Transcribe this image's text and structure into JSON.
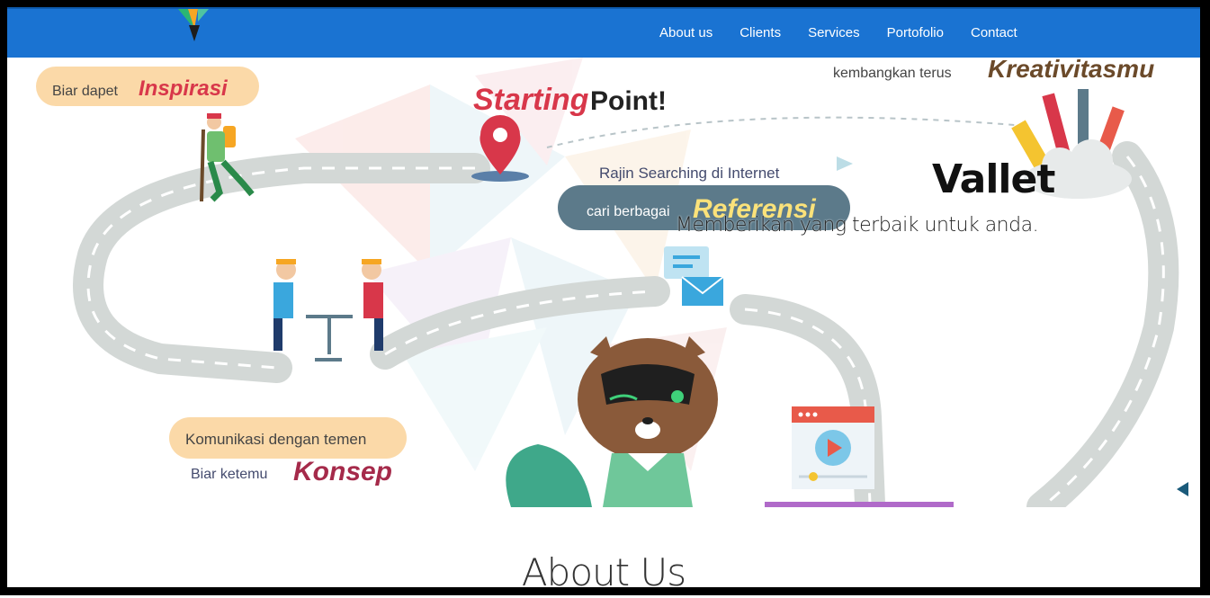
{
  "nav": {
    "brand_icon": "vallet-v-logo-icon",
    "links": [
      "About us",
      "Clients",
      "Services",
      "Portofolio",
      "Contact"
    ]
  },
  "hero": {
    "title": "Vallet",
    "subtitle": "Memberikan yang terbaik untuk anda.",
    "illustration": {
      "inspirasi_prefix": "Biar dapet",
      "inspirasi": "Inspirasi",
      "starting": "Starting",
      "point": "Point!",
      "searching": "Rajin Searching di Internet",
      "referensi_prefix": "cari berbagai",
      "referensi": "Referensi",
      "kreativitas_prefix": "kembangkan terus",
      "kreativitas": "Kreativitasmu",
      "komunikasi": "Komunikasi dengan temen",
      "konsep_prefix": "Biar ketemu",
      "konsep": "Konsep"
    },
    "carousel_prev_icon": "triangle-left-icon"
  },
  "about": {
    "heading": "About Us"
  },
  "colors": {
    "navbar": "#1a73d2",
    "road": "#d5d9d8",
    "accent_red": "#d8374a",
    "accent_cream": "#fbd9a8"
  }
}
